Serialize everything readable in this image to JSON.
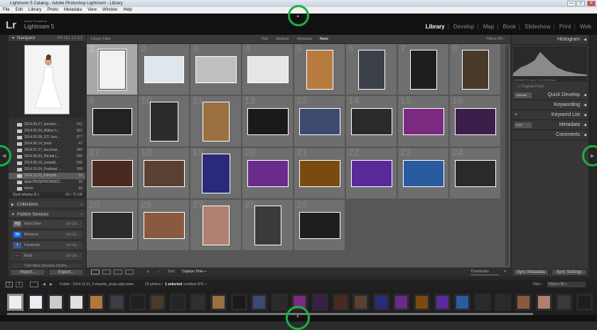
{
  "window": {
    "title": "Lightroom 5 Catalog - Adobe Photoshop Lightroom - Library",
    "min": "—",
    "max": "□",
    "close": "✕"
  },
  "menu": [
    "File",
    "Edit",
    "Library",
    "Photo",
    "Metadata",
    "View",
    "Window",
    "Help"
  ],
  "brand": {
    "logo": "Lr",
    "small": "Adobe Photoshop",
    "name": "Lightroom 5"
  },
  "modules": [
    {
      "label": "Library",
      "active": true
    },
    {
      "label": "Develop"
    },
    {
      "label": "Map"
    },
    {
      "label": "Book"
    },
    {
      "label": "Slideshow"
    },
    {
      "label": "Print"
    },
    {
      "label": "Web"
    }
  ],
  "module_sep": "|",
  "navigator": {
    "title": "Navigator",
    "opts": "FIT  FILL  1:1  3:1"
  },
  "folders": [
    {
      "name": "2014.04.27_koncert ...",
      "count": "231"
    },
    {
      "name": "2014.05.04_Wiktor k...",
      "count": "961"
    },
    {
      "name": "2014.05.08_STL kon...",
      "count": "677"
    },
    {
      "name": "2014.06.14_book",
      "count": "47"
    },
    {
      "name": "2014.07.27_koczmar...",
      "count": "389"
    },
    {
      "name": "2014.08.03_Michał L...",
      "count": "295"
    },
    {
      "name": "2014.09.19_Izzardd...",
      "count": "246"
    },
    {
      "name": "2014.10.04_Festiwal ...",
      "count": "398"
    },
    {
      "name": "2014.11.01_Fotopoli...",
      "count": "29",
      "selected": true
    },
    {
      "name": "dział PRZEPROWADZ...",
      "count": "26"
    },
    {
      "name": "różne",
      "count": "66"
    }
  ],
  "volume": {
    "name": "Dysk lokalny (F:)",
    "info": "66 / 75 GB"
  },
  "collections": {
    "title": "Collections"
  },
  "publish": {
    "title": "Publish Services",
    "items": [
      {
        "icon": "HD",
        "name": "Hard Drive",
        "set": "Set Up..."
      },
      {
        "icon": "Bē",
        "name": "Behance",
        "set": "Set Up..."
      },
      {
        "icon": "f",
        "name": "Facebook",
        "set": "Set Up..."
      },
      {
        "icon": "●●",
        "name": "Flickr",
        "set": "Set Up..."
      }
    ],
    "find": "Find More Services Online..."
  },
  "left_buttons": {
    "import": "Import...",
    "export": "Export..."
  },
  "filterbar": {
    "title": "Library Filter :",
    "text": "Text",
    "attribute": "Attribute",
    "metadata": "Metadata",
    "none": "None",
    "filters": "Filters Off ÷"
  },
  "grid_numbers": [
    "1",
    "2",
    "3",
    "4",
    "5",
    "6",
    "7",
    "8",
    "9",
    "10",
    "11",
    "12",
    "13",
    "14",
    "15",
    "16",
    "17",
    "18",
    "19",
    "20",
    "21",
    "22",
    "23",
    "24",
    "25",
    "26",
    "27",
    "28",
    "29"
  ],
  "toolbar": {
    "sort_label": "Sort:",
    "sort_value": "Capture Time ÷",
    "thumbnails": "Thumbnails"
  },
  "right": {
    "histogram": "Histogram",
    "hist_info": "ISO 800   70 mm   f / 2,8   1/160 sec",
    "original": "Original Photo",
    "defaults": "Defaults",
    "quick_develop": "Quick Develop",
    "keywording": "Keywording",
    "keyword_list": "Keyword List",
    "metadata_preset": "EXIF",
    "metadata": "Metadata",
    "comments": "Comments",
    "sync_metadata": "Sync Metadata",
    "sync_settings": "Sync Settings"
  },
  "filmstrip_head": {
    "page1": "1",
    "page2": "2",
    "path": "Folder : 2014.11.01_Fotopolis_sesja zdjęciowa",
    "photos": "29 photos /",
    "selected": "1 selected",
    "file": "/untitled.JPG ÷",
    "filter_label": "Filter :",
    "filter_value": "Filters Off ÷"
  },
  "colors": {
    "accent": "#1cb040",
    "selected_cell": "#a9a9a9",
    "cell": "#6e6e6e"
  }
}
